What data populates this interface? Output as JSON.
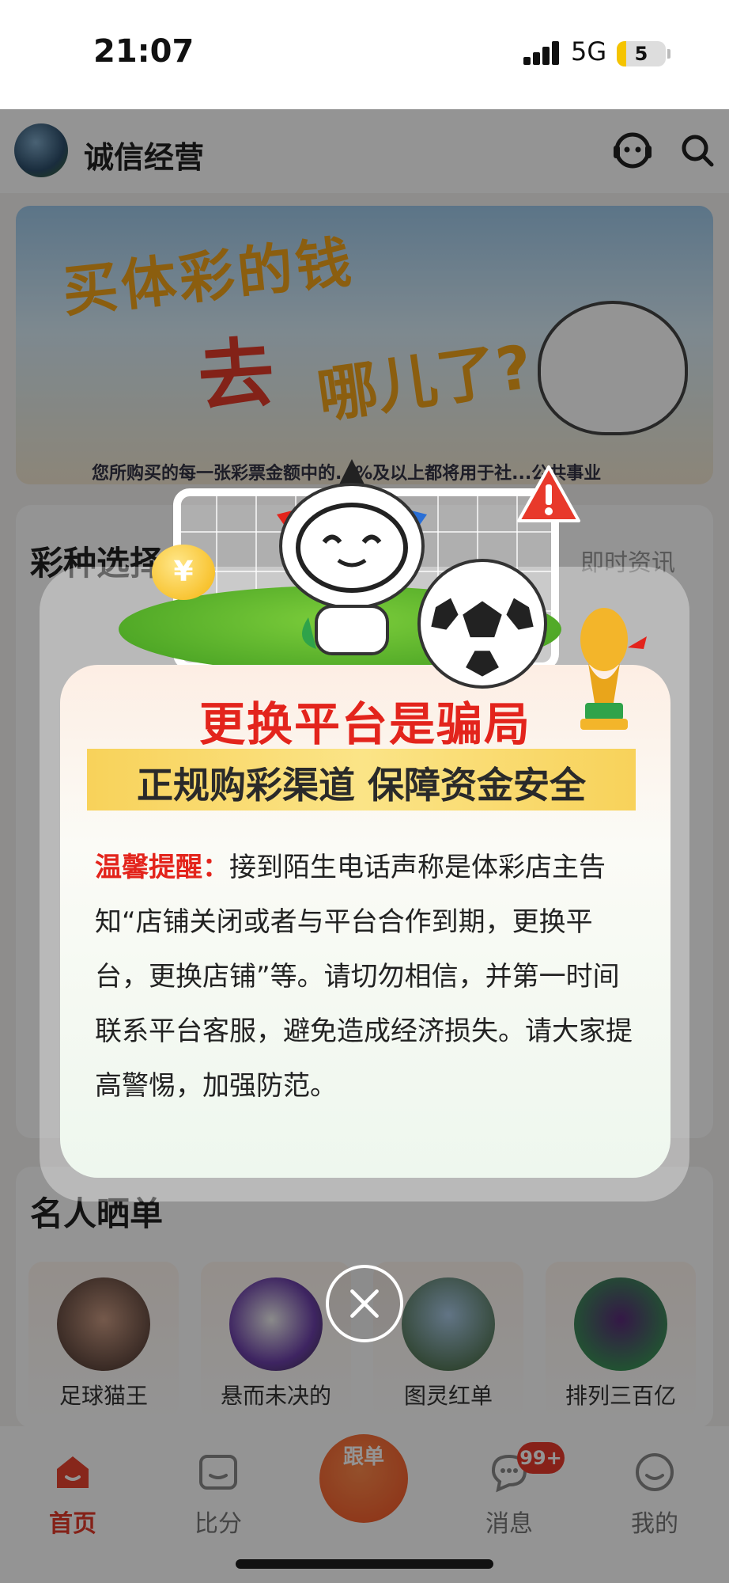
{
  "status_bar": {
    "time": "21:07",
    "network": "5G",
    "battery": "5"
  },
  "header": {
    "shop_name": "诚信经营",
    "icons": [
      "customer-service-icon",
      "search-icon"
    ]
  },
  "banner": {
    "line1": "买体彩的钱",
    "line2": "去",
    "line3": "哪儿了?",
    "note": "您所购买的每一张彩票金额中的...%及以上都将用于社...公共事业"
  },
  "sections": {
    "lottery_title": "彩种选择",
    "news_link": "即时资讯",
    "celebrity_title": "名人晒单",
    "celebrities": [
      {
        "name": "足球猫王"
      },
      {
        "name": "悬而未决的"
      },
      {
        "name": "图灵红单"
      },
      {
        "name": "排列三百亿"
      }
    ]
  },
  "tabbar": {
    "home": "首页",
    "scores": "比分",
    "follow": "跟单",
    "messages": "消息",
    "messages_badge": "99+",
    "mine": "我的"
  },
  "modal": {
    "title": "更换平台是骗局",
    "subtitle": "正规购彩渠道 保障资金安全",
    "warning_label": "温馨提醒：",
    "body": "接到陌生电话声称是体彩店主告知“店铺关闭或者与平台合作到期，更换平台，更换店铺”等。请切勿相信，并第一时间联系平台客服，避免造成经济损失。请大家提高警惕，加强防范。",
    "coin_symbol": "¥"
  },
  "colors": {
    "accent_red": "#e3241c",
    "ribbon_yellow": "#f8d25a",
    "tab_active": "#e33a2a"
  }
}
